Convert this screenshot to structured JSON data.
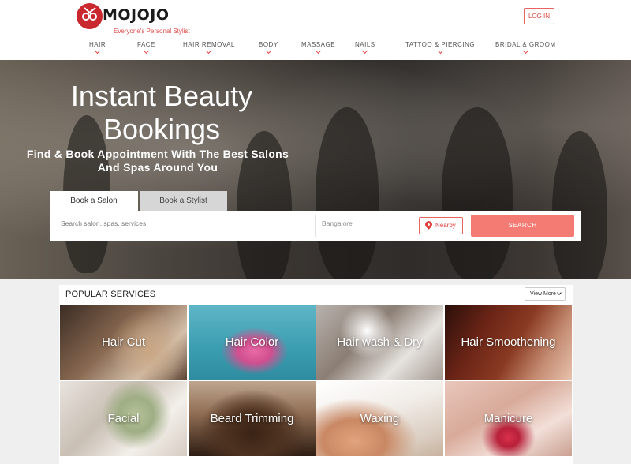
{
  "brand": {
    "name": "MOJOJO",
    "tagline": "Everyone's Personal Stylist",
    "accent_color": "#e0413d",
    "logo_color": "#c8282e"
  },
  "header": {
    "login_label": "LOG IN"
  },
  "nav": {
    "items": [
      {
        "label": "HAIR"
      },
      {
        "label": "FACE"
      },
      {
        "label": "HAIR REMOVAL"
      },
      {
        "label": "BODY"
      },
      {
        "label": "MASSAGE"
      },
      {
        "label": "NAILS"
      },
      {
        "label": "TATTOO & PIERCING"
      },
      {
        "label": "BRIDAL & GROOM"
      }
    ],
    "chevron_icon": "chevron-down-icon"
  },
  "hero": {
    "title": "Instant Beauty Bookings",
    "subtitle": "Find & Book Appointment With The Best Salons And Spas Around You",
    "tabs": [
      {
        "label": "Book a Salon",
        "active": true
      },
      {
        "label": "Book a Stylist",
        "active": false
      }
    ],
    "search": {
      "placeholder": "Search salon, spas, services",
      "city_value": "Bangalore",
      "nearby_label": "Nearby",
      "nearby_icon": "map-pin-icon",
      "search_label": "SEARCH",
      "search_color": "#f47b73"
    }
  },
  "services": {
    "title": "POPULAR SERVICES",
    "view_more_label": "View More",
    "items": [
      {
        "label": "Hair Cut"
      },
      {
        "label": "Hair Color"
      },
      {
        "label": "Hair wash & Dry"
      },
      {
        "label": "Hair Smoothening"
      },
      {
        "label": "Facial"
      },
      {
        "label": "Beard Trimming"
      },
      {
        "label": "Waxing"
      },
      {
        "label": "Manicure"
      }
    ]
  }
}
